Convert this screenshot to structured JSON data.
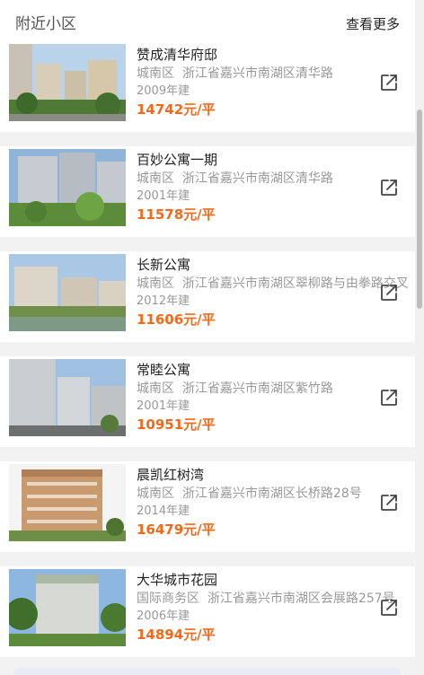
{
  "header": {
    "title": "附近小区",
    "more_label": "查看更多"
  },
  "communities": [
    {
      "name": "赞成清华府邸",
      "district": "城南区",
      "address": "浙江省嘉兴市南湖区清华路",
      "year": "2009年建",
      "price": "14742元/平",
      "icon": "external-link-icon"
    },
    {
      "name": "百妙公寓一期",
      "district": "城南区",
      "address": "浙江省嘉兴市南湖区清华路",
      "year": "2001年建",
      "price": "11578元/平",
      "icon": "external-link-icon"
    },
    {
      "name": "长新公寓",
      "district": "城南区",
      "address": "浙江省嘉兴市南湖区翠柳路与由拳路交叉口",
      "year": "2012年建",
      "price": "11606元/平",
      "icon": "external-link-icon"
    },
    {
      "name": "常睦公寓",
      "district": "城南区",
      "address": "浙江省嘉兴市南湖区紫竹路",
      "year": "2001年建",
      "price": "10951元/平",
      "icon": "external-link-icon"
    },
    {
      "name": "晨凯红树湾",
      "district": "城南区",
      "address": "浙江省嘉兴市南湖区长桥路28号",
      "year": "2014年建",
      "price": "16479元/平",
      "icon": "external-link-icon"
    },
    {
      "name": "大华城市花园",
      "district": "国际商务区",
      "address": "浙江省嘉兴市南湖区会展路257号",
      "year": "2006年建",
      "price": "14894元/平",
      "icon": "external-link-icon"
    }
  ],
  "colors": {
    "price": "#f26a19",
    "text_primary": "#222222",
    "text_secondary": "#999999",
    "background": "#f2f2f2"
  }
}
